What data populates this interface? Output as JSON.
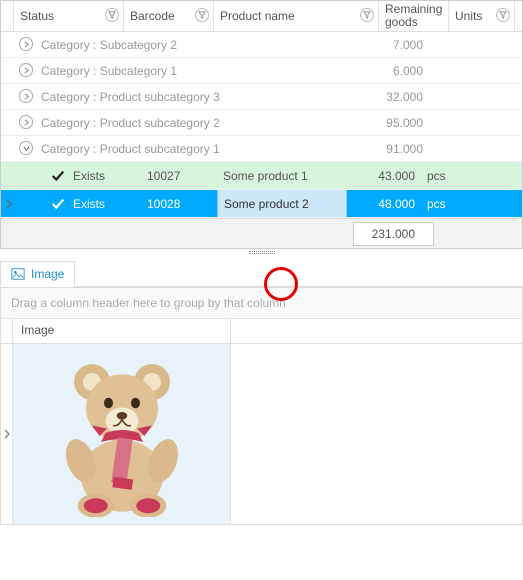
{
  "columns": {
    "status": "Status",
    "barcode": "Barcode",
    "product_name": "Product name",
    "remaining": "Remaining goods",
    "units": "Units"
  },
  "groups": [
    {
      "label": "Category : Subcategory 2",
      "value": "7.000",
      "expanded": false
    },
    {
      "label": "Category : Subcategory 1",
      "value": "6.000",
      "expanded": false
    },
    {
      "label": "Category : Product subcategory 3",
      "value": "32.000",
      "expanded": false
    },
    {
      "label": "Category : Product subcategory 2",
      "value": "95.000",
      "expanded": false
    },
    {
      "label": "Category : Product subcategory 1",
      "value": "91.000",
      "expanded": true
    }
  ],
  "rows": [
    {
      "status": "Exists",
      "barcode": "10027",
      "product": "Some product 1",
      "remaining": "43.000",
      "units": "pcs",
      "selected": false
    },
    {
      "status": "Exists",
      "barcode": "10028",
      "product": "Some product 2",
      "remaining": "48.000",
      "units": "pcs",
      "selected": true
    }
  ],
  "summary_total": "231.000",
  "detail_tab": "Image",
  "group_hint": "Drag a column header here to group by that column",
  "image_column": "Image"
}
